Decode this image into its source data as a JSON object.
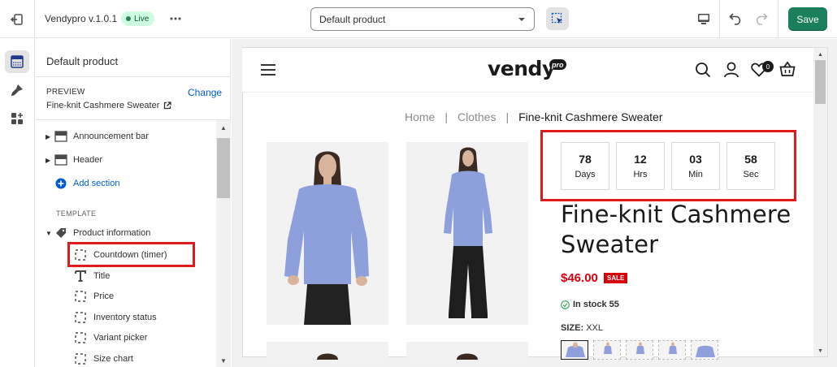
{
  "topbar": {
    "app_name": "Vendypro v.1.0.1",
    "live_label": "Live",
    "template_select": "Default product",
    "save_label": "Save"
  },
  "sidebar": {
    "title": "Default product",
    "preview_label": "PREVIEW",
    "change_label": "Change",
    "preview_value": "Fine-knit Cashmere Sweater",
    "sections": [
      {
        "label": "Announcement bar"
      },
      {
        "label": "Header"
      }
    ],
    "add_section_label": "Add section",
    "template_label": "TEMPLATE",
    "product_info_label": "Product information",
    "blocks": [
      {
        "label": "Countdown (timer)"
      },
      {
        "label": "Title"
      },
      {
        "label": "Price"
      },
      {
        "label": "Inventory status"
      },
      {
        "label": "Variant picker"
      },
      {
        "label": "Size chart"
      }
    ]
  },
  "store": {
    "logo_text": "vendy",
    "logo_badge": "pro",
    "wishlist_count": "0",
    "breadcrumb": {
      "home": "Home",
      "sep": "|",
      "category": "Clothes",
      "current": "Fine-knit Cashmere Sweater"
    },
    "countdown": [
      {
        "value": "78",
        "unit": "Days"
      },
      {
        "value": "12",
        "unit": "Hrs"
      },
      {
        "value": "03",
        "unit": "Min"
      },
      {
        "value": "58",
        "unit": "Sec"
      }
    ],
    "product": {
      "title": "Fine-knit Cashmere Sweater",
      "price": "$46.00",
      "sale_badge": "SALE",
      "stock": "In stock 55",
      "size_label": "SIZE:",
      "size_value": "XXL"
    }
  },
  "colors": {
    "accent_green": "#1a7f5a",
    "link_blue": "#005bd3",
    "highlight_red": "#e01b1b",
    "price_red": "#d8000c",
    "sweater_blue": "#8ea0db"
  }
}
